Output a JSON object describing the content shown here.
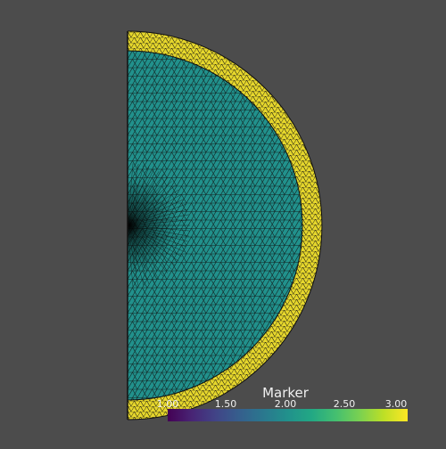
{
  "viewer": {
    "background_color": "#4c4c4c",
    "mesh": {
      "edge_color": "#111111",
      "regions": [
        {
          "marker": 2,
          "color": "#21918c"
        },
        {
          "marker": 3,
          "color": "#e5d62c"
        }
      ]
    },
    "colorbar": {
      "title": "Marker",
      "colormap": "viridis",
      "ticks": [
        "1.00",
        "1.50",
        "2.00",
        "2.50",
        "3.00"
      ]
    }
  }
}
